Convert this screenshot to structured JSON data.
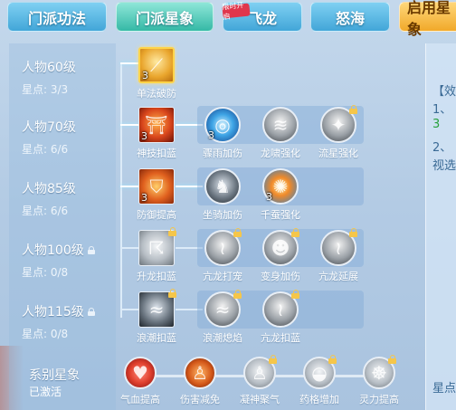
{
  "tabs": [
    {
      "label": "门派功法",
      "state": "inactive"
    },
    {
      "label": "门派星象",
      "state": "active"
    },
    {
      "label": "飞龙",
      "state": "inactive",
      "badge": "限时开启"
    },
    {
      "label": "怒海",
      "state": "inactive"
    },
    {
      "label": "启用星象",
      "state": "special"
    }
  ],
  "tiers": [
    {
      "level": "人物60级",
      "points": "星点: 3/3",
      "locked": false
    },
    {
      "level": "人物70级",
      "points": "星点: 6/6",
      "locked": false
    },
    {
      "level": "人物85级",
      "points": "星点: 6/6",
      "locked": false
    },
    {
      "level": "人物100级",
      "points": "星点: 0/8",
      "locked": true
    },
    {
      "level": "人物115级",
      "points": "星点: 0/8",
      "locked": true
    }
  ],
  "skills": {
    "r1": [
      {
        "name": "单法破防",
        "count": "3",
        "icon": "staff-icon"
      }
    ],
    "r2": [
      {
        "name": "神技扣蓝",
        "count": "3",
        "icon": "pagoda-icon"
      },
      {
        "name": "骤雨加伤",
        "count": "3",
        "icon": "vortex-icon"
      },
      {
        "name": "龙啸强化",
        "count": "",
        "icon": "dragon-roar-icon"
      },
      {
        "name": "流星强化",
        "count": "",
        "icon": "meteor-icon"
      }
    ],
    "r3": [
      {
        "name": "防御提高",
        "count": "3",
        "icon": "shield-icon"
      },
      {
        "name": "坐骑加伤",
        "count": "",
        "icon": "mount-icon"
      },
      {
        "name": "千蚕强化",
        "count": "3",
        "icon": "silkworm-icon"
      }
    ],
    "r4": [
      {
        "name": "升龙扣蓝",
        "count": "",
        "icon": "rising-dragon-icon"
      },
      {
        "name": "亢龙打宠",
        "count": "",
        "icon": "dragon-strike-icon"
      },
      {
        "name": "变身加伤",
        "count": "",
        "icon": "transform-icon"
      },
      {
        "name": "亢龙延展",
        "count": "",
        "icon": "dragon-extend-icon"
      }
    ],
    "r5": [
      {
        "name": "浪潮扣蓝",
        "count": "",
        "icon": "wave-icon"
      },
      {
        "name": "浪潮熄焰",
        "count": "",
        "icon": "wave-flame-icon"
      },
      {
        "name": "亢龙扣蓝",
        "count": "",
        "icon": "dragon-mana-icon"
      }
    ]
  },
  "series": {
    "title": "系别星象",
    "status": "已激活",
    "items": [
      {
        "name": "气血提高",
        "icon": "heart-icon"
      },
      {
        "name": "伤害减免",
        "icon": "warrior-icon"
      },
      {
        "name": "凝神聚气",
        "icon": "focus-icon"
      },
      {
        "name": "药格增加",
        "icon": "potion-icon"
      },
      {
        "name": "灵力提高",
        "icon": "spirit-icon"
      }
    ]
  },
  "right_panel": {
    "lines": [
      "【效",
      "1、",
      "3",
      "2、",
      "视选",
      "星点"
    ]
  },
  "colors": {
    "tab_blue": "#42a6d8",
    "tab_active": "#35b9a6",
    "tab_gold": "#f1a92a",
    "lock": "#f5c64a",
    "selected_border": "#ffd44a",
    "green_text": "#26a03c"
  }
}
